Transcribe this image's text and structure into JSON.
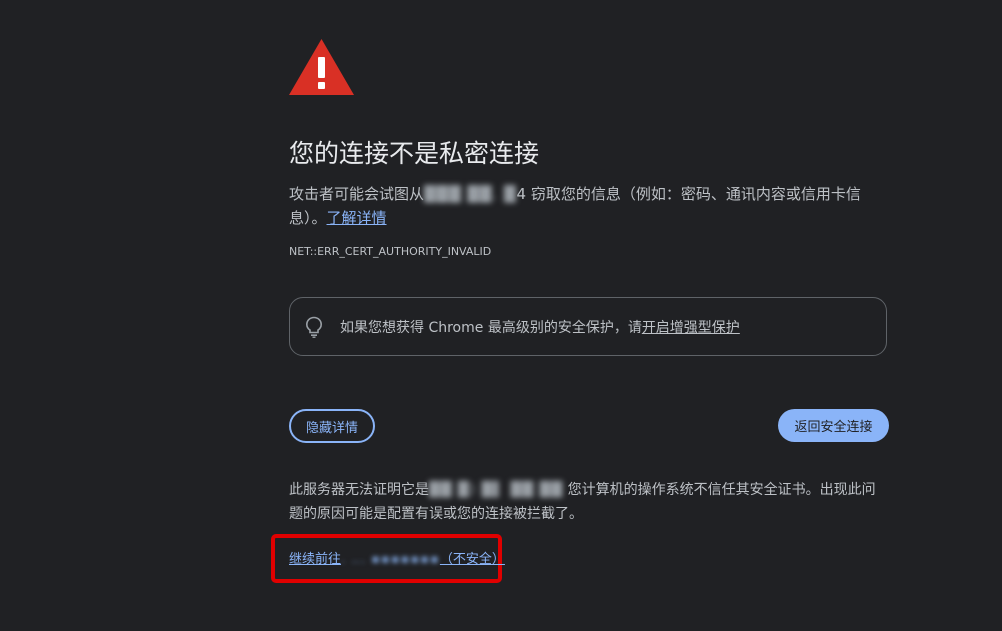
{
  "interstitial": {
    "icon": "warning-triangle-icon",
    "title": "您的连接不是私密连接",
    "description_before": "攻击者可能会试图从",
    "description_host_obscured": "4",
    "description_after": " 窃取您的信息（例如：密码、通讯内容或信用卡信息）。",
    "learn_more": "了解详情",
    "error_code": "NET::ERR_CERT_AUTHORITY_INVALID"
  },
  "enhanced_protection": {
    "icon": "lightbulb-icon",
    "text": "如果您想获得 Chrome 最高级别的安全保护，请",
    "link": "开启增强型保护"
  },
  "buttons": {
    "hide_details": "隐藏详情",
    "back_to_safety": "返回安全连接"
  },
  "details": {
    "text_before": "此服务器无法证明它是",
    "text_after": " 您计算机的操作系统不信任其安全证书。出现此问题的原因可能是配置有误或您的连接被拦截了。"
  },
  "proceed": {
    "prefix": "继续前往",
    "suffix": "（不安全）"
  },
  "colors": {
    "background": "#202124",
    "accent": "#8ab4f8",
    "warning_red": "#d93025",
    "highlight_box": "#e00000"
  }
}
